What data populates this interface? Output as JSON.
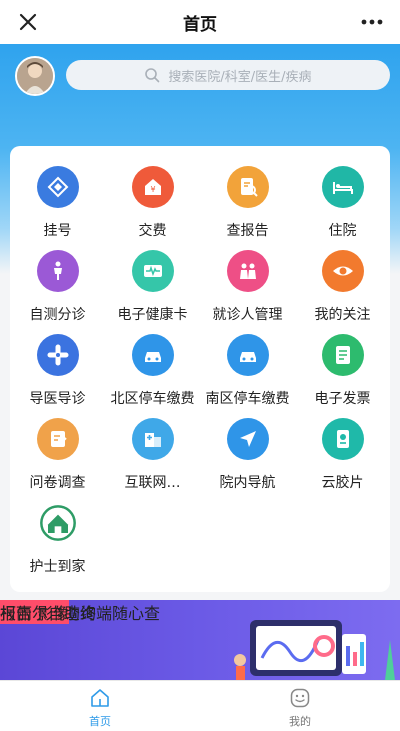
{
  "header": {
    "title": "首页"
  },
  "search": {
    "placeholder": "搜索医院/科室/医生/疾病"
  },
  "menu": [
    {
      "label": "挂号",
      "icon": "register-icon",
      "color": "#3a7be0"
    },
    {
      "label": "交费",
      "icon": "payment-icon",
      "color": "#ef5a3a"
    },
    {
      "label": "查报告",
      "icon": "report-icon",
      "color": "#f2a33a"
    },
    {
      "label": "住院",
      "icon": "bed-icon",
      "color": "#20b7a6"
    },
    {
      "label": "自测分诊",
      "icon": "body-icon",
      "color": "#9b59d6"
    },
    {
      "label": "电子健康卡",
      "icon": "health-card-icon",
      "color": "#35c6a9"
    },
    {
      "label": "就诊人管理",
      "icon": "family-icon",
      "color": "#ee4f86"
    },
    {
      "label": "我的关注",
      "icon": "eye-icon",
      "color": "#f27a2e"
    },
    {
      "label": "导医导诊",
      "icon": "guide-icon",
      "color": "#3b73e0"
    },
    {
      "label": "北区停车缴费",
      "icon": "car-icon",
      "color": "#2f95e8"
    },
    {
      "label": "南区停车缴费",
      "icon": "car-icon",
      "color": "#2f95e8"
    },
    {
      "label": "电子发票",
      "icon": "invoice-icon",
      "color": "#2dbb6e"
    },
    {
      "label": "问卷调查",
      "icon": "survey-icon",
      "color": "#f0a24a"
    },
    {
      "label": "互联网…",
      "icon": "hospital-icon",
      "color": "#3fa8e8"
    },
    {
      "label": "院内导航",
      "icon": "navigation-icon",
      "color": "#2f95e8"
    },
    {
      "label": "云胶片",
      "icon": "film-icon",
      "color": "#1fb9a9"
    },
    {
      "label": "护士到家",
      "icon": "nurse-home-logo",
      "color": "#2e9c66"
    }
  ],
  "banner": {
    "title": "全院报告查询",
    "tag": "报告 影像",
    "subtitle": "柯丽尔自助终端随心查"
  },
  "tabs": [
    {
      "label": "首页",
      "active": true
    },
    {
      "label": "我的",
      "active": false
    }
  ]
}
